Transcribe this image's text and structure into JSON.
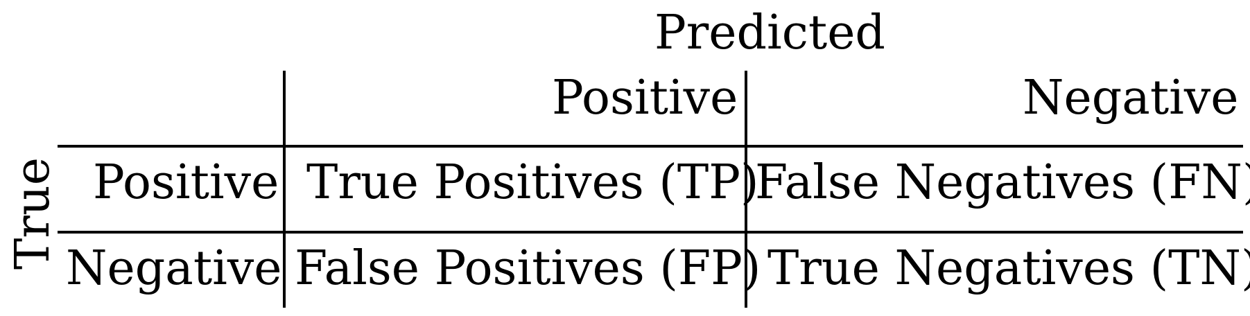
{
  "matrix": {
    "top_header": "Predicted",
    "side_header": "True",
    "column_headers": [
      "Positive",
      "Negative"
    ],
    "row_headers": [
      "Positive",
      "Negative"
    ],
    "cells": [
      [
        "True Positives (TP)",
        "False Negatives (FN)"
      ],
      [
        "False Positives (FP)",
        "True Negatives (TN)"
      ]
    ]
  }
}
